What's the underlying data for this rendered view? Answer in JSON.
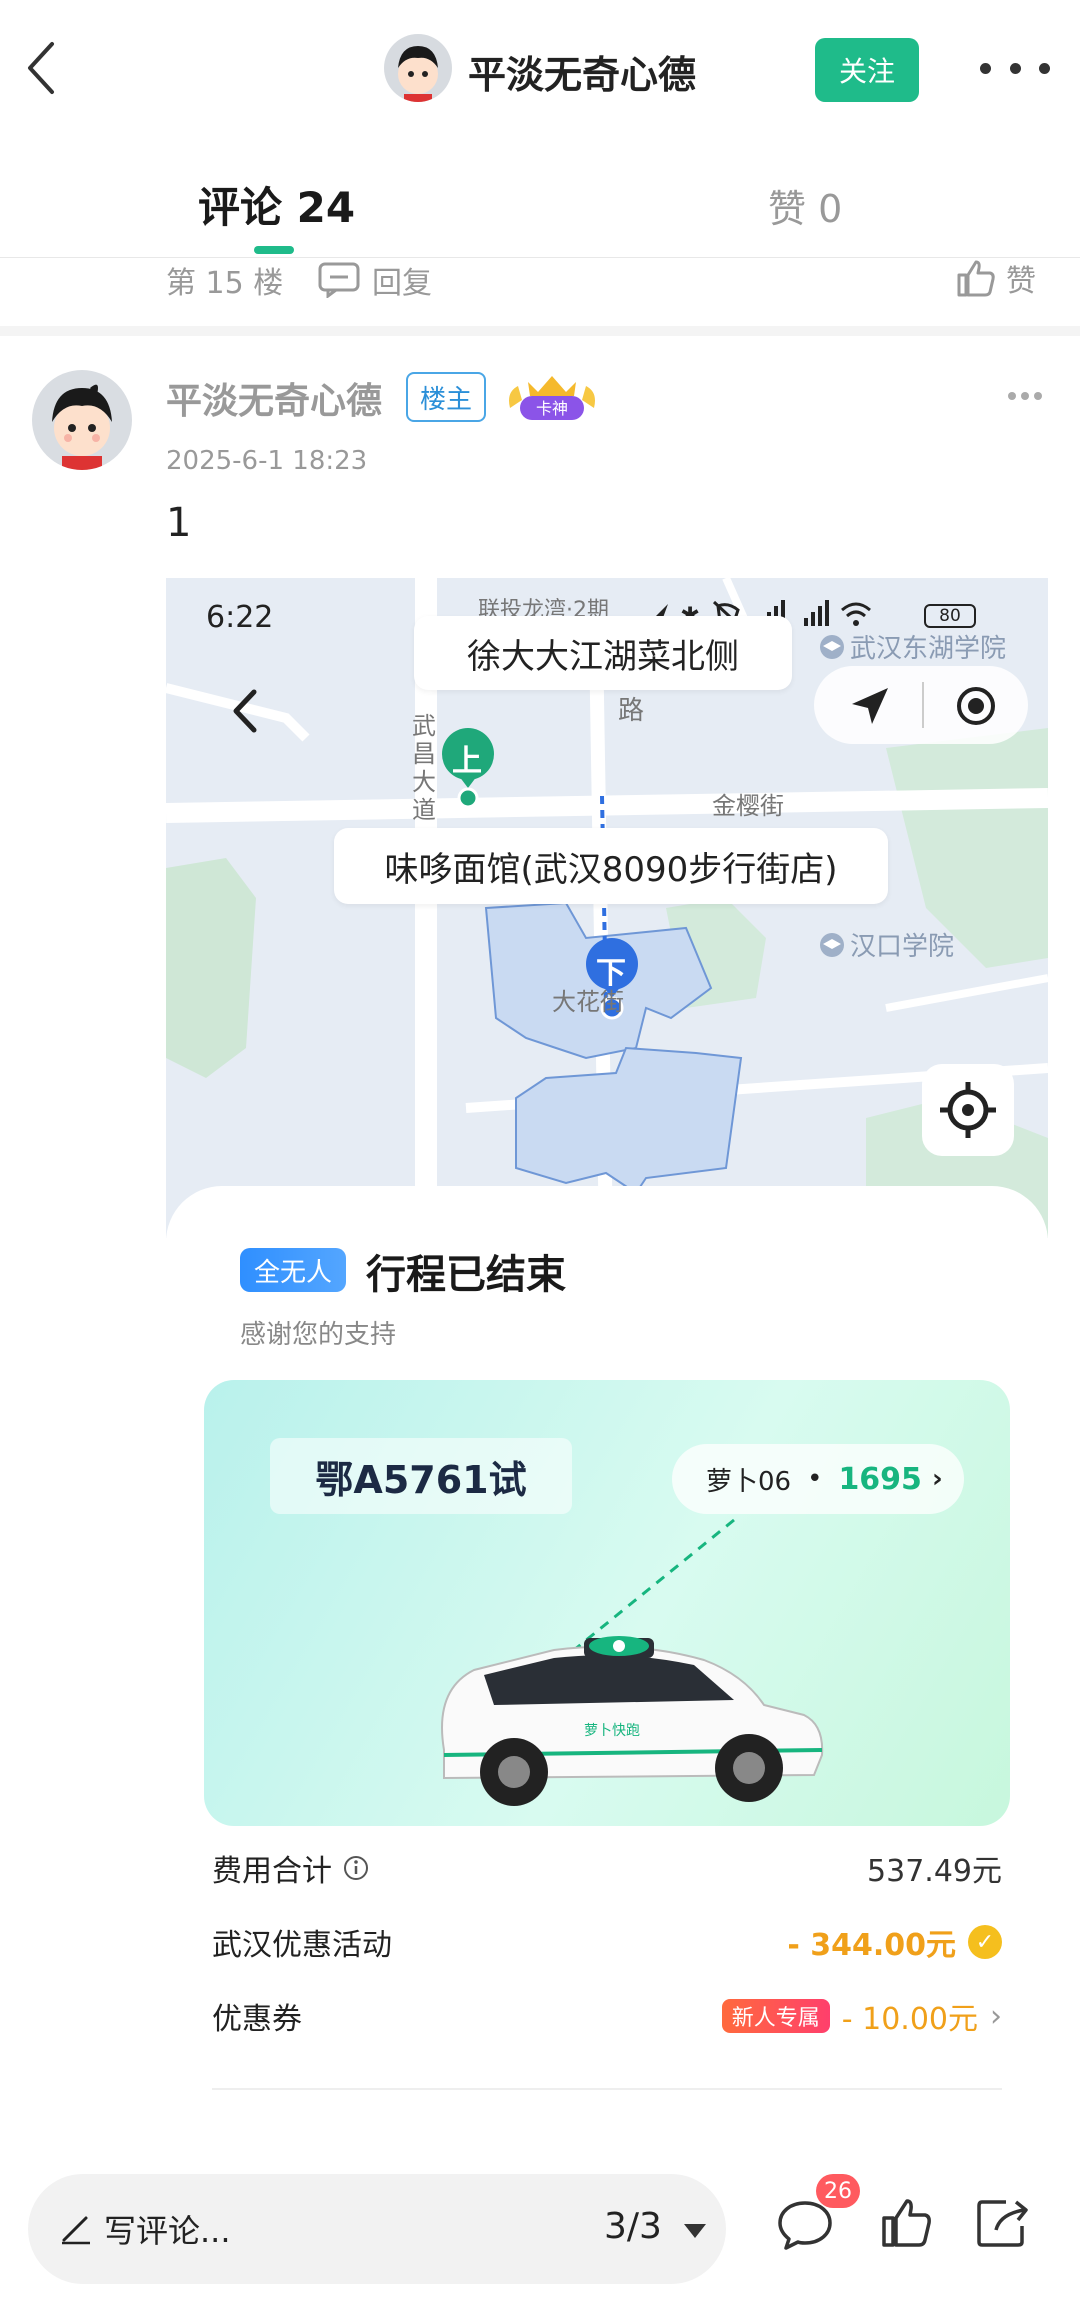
{
  "header": {
    "user_name": "平淡无奇心德",
    "follow_label": "关注"
  },
  "tabs": {
    "comments_label": "评论 24",
    "likes_label": "赞 0"
  },
  "previous_floor": {
    "floor_label": "第 15 楼",
    "reply_label": "回复",
    "like_label": "赞"
  },
  "comment": {
    "author": "平淡无奇心德",
    "op_badge": "楼主",
    "rank_badge": "卡神",
    "timestamp": "2025-6-1 18:23",
    "text": "1"
  },
  "screenshot": {
    "status_time": "6:22",
    "status_extra": "联投龙湾·2期",
    "battery": "80",
    "pickup_location": "徐大大江湖菜北侧",
    "dropoff_location": "味哆面馆(武汉8090步行街店)",
    "pickup_pin": "上",
    "dropoff_pin": "下",
    "map_labels": {
      "road_1": "武昌大道",
      "road_2": "金樱街",
      "road_3": "大花街",
      "road_4": "路",
      "poi_1": "武汉东湖学院",
      "poi_2": "汉口学院"
    },
    "trip": {
      "service_badge": "全无人",
      "status": "行程已结束",
      "thanks": "感谢您的支持",
      "plate": "鄂A5761试",
      "vehicle_name": "萝卜06",
      "vehicle_number": "1695",
      "car_brand_text": "萝卜快跑"
    },
    "fees": {
      "total_label": "费用合计",
      "total_value": "537.49元",
      "promo_label": "武汉优惠活动",
      "promo_value": "- 344.00元",
      "coupon_label": "优惠券",
      "coupon_badge": "新人专属",
      "coupon_value": "- 10.00元"
    }
  },
  "bottom_bar": {
    "input_placeholder": "写评论...",
    "page_indicator": "3/3",
    "comment_count_badge": "26"
  },
  "colors": {
    "accent_green": "#1fbb8a",
    "op_blue": "#2b8fd8",
    "discount_orange": "#f0a01a",
    "badge_red": "#ff5a5f"
  }
}
